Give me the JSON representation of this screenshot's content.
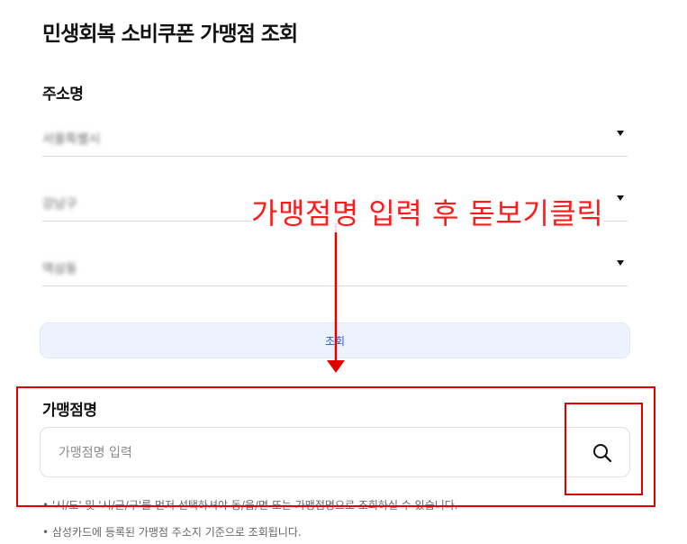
{
  "page": {
    "title": "민생회복 소비쿠폰 가맹점 조회"
  },
  "address": {
    "label": "주소명",
    "selects": [
      {
        "value": "서울특별시"
      },
      {
        "value": "강남구"
      },
      {
        "value": "역삼동"
      }
    ]
  },
  "search_button": {
    "label": "조회"
  },
  "store": {
    "label": "가맹점명",
    "placeholder": "가맹점명 입력",
    "search_icon": "search-icon"
  },
  "notes": [
    "• '시/도' 및 '시/군/구'를 먼저 선택하셔야 동/읍/면 또는 가맹점명으로 조회하실 수 있습니다.",
    "• 삼성카드에 등록된 가맹점 주소지 기준으로 조회됩니다."
  ],
  "annotation": {
    "text": "가맹점명 입력 후 돋보기클릭",
    "color": "#e00000"
  }
}
